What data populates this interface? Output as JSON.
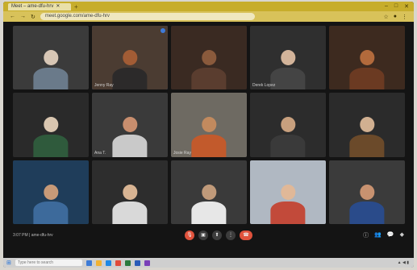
{
  "browser": {
    "tab_title": "Meet – ame-dfu-hrv",
    "url": "meet.google.com/ame-dfu-hrv"
  },
  "meeting": {
    "time_code": "3:07 PM | ame-dfu-hrv"
  },
  "taskbar": {
    "search_placeholder": "Type here to search"
  },
  "participants": [
    {
      "name": "",
      "bg": "#3b3b3b",
      "shirt": "#6a7a8a",
      "skin": "#d7c6b5"
    },
    {
      "name": "Jenny Ray",
      "bg": "#4b3c32",
      "shirt": "#2c2a2a",
      "skin": "#a25c35",
      "active": true
    },
    {
      "name": "",
      "bg": "#3a2a22",
      "shirt": "#5a3d2f",
      "skin": "#8a5a3c"
    },
    {
      "name": "Derek Lopez",
      "bg": "#2f2f2f",
      "shirt": "#444",
      "skin": "#d3b49a"
    },
    {
      "name": "",
      "bg": "#3d2a1f",
      "shirt": "#6b3a22",
      "skin": "#b26a3c"
    },
    {
      "name": "",
      "bg": "#2a2a2a",
      "shirt": "#2f5a3c",
      "skin": "#d9c6b0"
    },
    {
      "name": "Ana T.",
      "bg": "#3a3a3a",
      "shirt": "#c9c9c9",
      "skin": "#c88e6e"
    },
    {
      "name": "Josie Ray",
      "bg": "#6e6a62",
      "shirt": "#c25a2c",
      "skin": "#c28a5e"
    },
    {
      "name": "",
      "bg": "#2c2c2c",
      "shirt": "#3a3a3a",
      "skin": "#c8a07e"
    },
    {
      "name": "",
      "bg": "#2b2b2b",
      "shirt": "#6b4a2a",
      "skin": "#d1b091"
    },
    {
      "name": "",
      "bg": "#1f3d5a",
      "shirt": "#3d6a9b",
      "skin": "#c79a78"
    },
    {
      "name": "",
      "bg": "#2d2d2d",
      "shirt": "#d9d9d9",
      "skin": "#d8b493"
    },
    {
      "name": "",
      "bg": "#3a3a3a",
      "shirt": "#e7e7e7",
      "skin": "#c09a7a"
    },
    {
      "name": "",
      "bg": "#b0b8c2",
      "shirt": "#c24a3a",
      "skin": "#e0b898"
    },
    {
      "name": "",
      "bg": "#3b3b3b",
      "shirt": "#2a4b8a",
      "skin": "#c89270"
    }
  ]
}
